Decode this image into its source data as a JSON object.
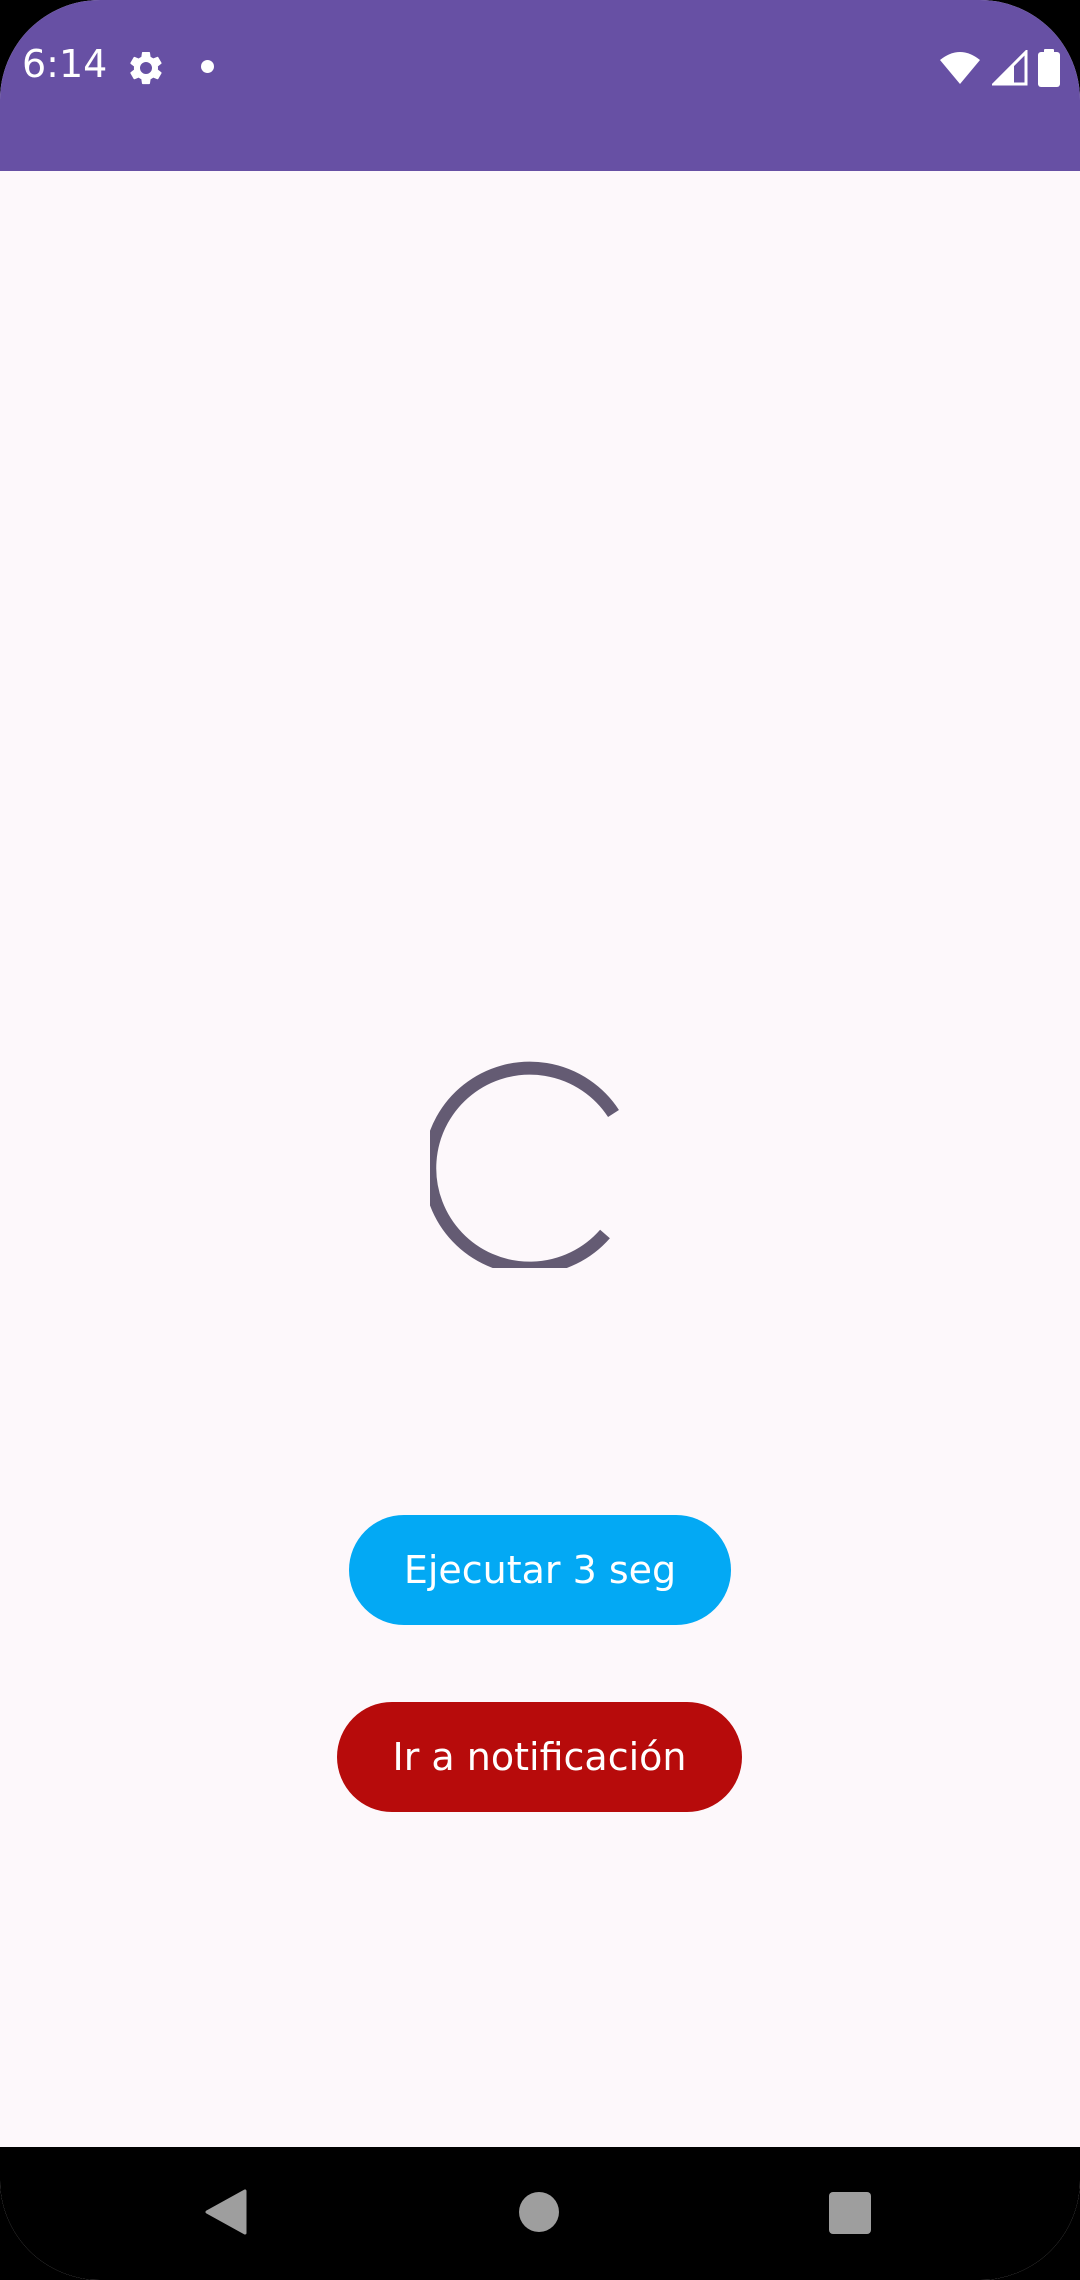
{
  "status_bar": {
    "time": "6:14",
    "icons": [
      "gear-icon",
      "notification-dot-icon",
      "wifi-icon",
      "signal-icon",
      "battery-icon"
    ],
    "background": "#6750a4"
  },
  "main": {
    "loading_indicator": "progress-spinner-icon",
    "buttons": {
      "run": {
        "label": "Ejecutar 3 seg",
        "color": "#03a9f4"
      },
      "notification": {
        "label": "Ir a notificación",
        "color": "#b70b0b"
      }
    },
    "spinner_color": "#645b73",
    "background": "#fdf8fb"
  },
  "nav_bar": {
    "icons": [
      "back-icon",
      "home-icon",
      "recents-icon"
    ]
  }
}
